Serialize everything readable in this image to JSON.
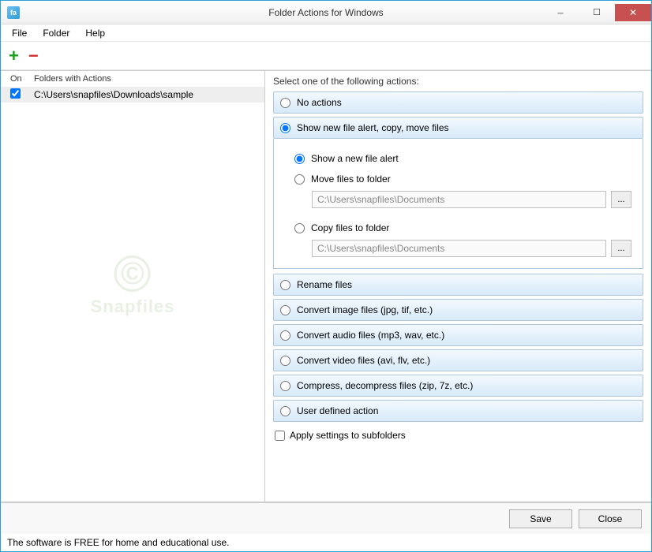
{
  "window": {
    "title": "Folder Actions for Windows",
    "app_icon_text": "fa"
  },
  "menu": {
    "file": "File",
    "folder": "Folder",
    "help": "Help"
  },
  "left": {
    "col_on": "On",
    "col_folders": "Folders with Actions",
    "folder_path": "C:\\Users\\snapfiles\\Downloads\\sample",
    "folder_checked": true
  },
  "right": {
    "heading": "Select one of the following actions:",
    "actions": {
      "none": "No actions",
      "show_alert": "Show new file alert, copy, move files",
      "rename": "Rename files",
      "convert_image": "Convert image files (jpg, tif, etc.)",
      "convert_audio": "Convert audio files (mp3, wav, etc.)",
      "convert_video": "Convert video files (avi, flv, etc.)",
      "compress": "Compress, decompress files (zip, 7z, etc.)",
      "user_defined": "User defined action"
    },
    "sub": {
      "show_alert": "Show a new file alert",
      "move": "Move files to folder",
      "move_path": "C:\\Users\\snapfiles\\Documents",
      "copy": "Copy files to folder",
      "copy_path": "C:\\Users\\snapfiles\\Documents",
      "browse": "..."
    },
    "apply_subfolders": "Apply settings to subfolders"
  },
  "footer": {
    "save": "Save",
    "close": "Close"
  },
  "status": {
    "text": "The software is FREE for home and educational use."
  },
  "watermark": {
    "c": "©",
    "text": "Snapfiles"
  }
}
